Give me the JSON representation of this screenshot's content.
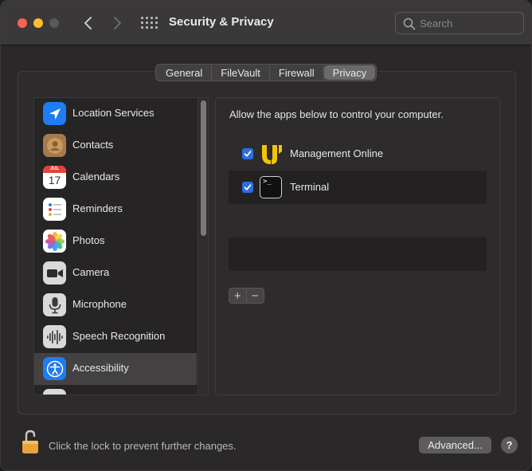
{
  "window": {
    "title": "Security & Privacy",
    "search_placeholder": "Search"
  },
  "tabs": [
    {
      "label": "General",
      "active": false
    },
    {
      "label": "FileVault",
      "active": false
    },
    {
      "label": "Firewall",
      "active": false
    },
    {
      "label": "Privacy",
      "active": true
    }
  ],
  "sidebar": {
    "items": [
      {
        "label": "Location Services",
        "icon": "location-arrow-icon"
      },
      {
        "label": "Contacts",
        "icon": "contacts-icon"
      },
      {
        "label": "Calendars",
        "icon": "calendar-icon",
        "icon_month": "JUL",
        "icon_day": "17"
      },
      {
        "label": "Reminders",
        "icon": "reminders-icon"
      },
      {
        "label": "Photos",
        "icon": "photos-icon"
      },
      {
        "label": "Camera",
        "icon": "camera-icon"
      },
      {
        "label": "Microphone",
        "icon": "microphone-icon"
      },
      {
        "label": "Speech Recognition",
        "icon": "speech-waveform-icon"
      },
      {
        "label": "Accessibility",
        "icon": "accessibility-icon",
        "selected": true
      }
    ]
  },
  "panel": {
    "description": "Allow the apps below to control your computer.",
    "apps": [
      {
        "label": "Management Online",
        "checked": true,
        "icon": "management-online-icon"
      },
      {
        "label": "Terminal",
        "checked": true,
        "icon": "terminal-icon",
        "icon_prompt": ">_"
      }
    ],
    "add_label": "+",
    "remove_label": "−"
  },
  "footer": {
    "lock_text": "Click the lock to prevent further changes.",
    "advanced_label": "Advanced...",
    "help_label": "?"
  },
  "colors": {
    "accent_blue": "#2d6fe0",
    "selected_row": "#434142",
    "window_bg": "#2a2829"
  }
}
